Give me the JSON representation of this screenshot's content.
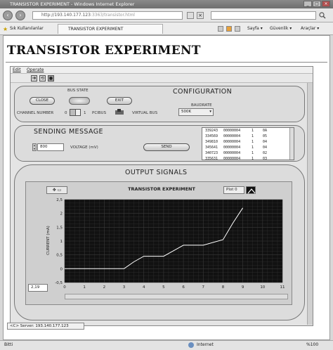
{
  "window": {
    "title": "TRANSISTOR EXPERIMENT - Windows Internet Explorer"
  },
  "browser": {
    "url": "http://193.140.177.123",
    "url_suffix": ":3363/transistor.html",
    "favorites_label": "Sık Kullanılanlar",
    "tab_title": "TRANSISTOR EXPERIMENT",
    "menu_page": "Sayfa ▾",
    "menu_security": "Güvenlik ▾",
    "menu_tools": "Araçlar ▾",
    "status_left": "Bitti",
    "status_zone": "Internet",
    "zoom": "%100"
  },
  "page": {
    "title": "TRANSISTOR EXPERIMENT"
  },
  "vi": {
    "menu": {
      "edit": "Edit",
      "operate": "Operate"
    },
    "config": {
      "title": "CONFIGURATION",
      "bus_state_label": "BUS STATE",
      "close_label": "CLOSE",
      "exit_label": "EXIT",
      "channel_label": "CHANNEL NUMBER",
      "channel_min": "0",
      "channel_max": "1",
      "pcibus_label": "PCIBUS",
      "virtual_bus_label": "VIRTUAL BUS",
      "baudrate_label": "BAUDRATE",
      "baudrate_value": "500K"
    },
    "sending": {
      "title": "SENDING MESSAGE",
      "voltage_value": "800",
      "voltage_label": "VOLTAGE (mV)",
      "send_label": "SEND",
      "log": [
        [
          "339243",
          "00000004",
          "1",
          "0A"
        ],
        [
          "334569",
          "00000004",
          "1",
          "05"
        ],
        [
          "349810",
          "00000004",
          "1",
          "04"
        ],
        [
          "345641",
          "00000004",
          "1",
          "04"
        ],
        [
          "340723",
          "00000004",
          "1",
          "02"
        ],
        [
          "335631",
          "00000004",
          "1",
          "03"
        ]
      ]
    },
    "output": {
      "title": "OUTPUT SIGNALS",
      "plot_legend": "Plot 0",
      "cursor_value": "2,19"
    },
    "taskbar_item": "<C> Server: 193.140.177.123"
  },
  "chart_data": {
    "type": "line",
    "title": "TRANSISTOR EXPERIMENT",
    "xlabel": "",
    "ylabel": "CURRENT (mA)",
    "xlim": [
      0,
      11
    ],
    "ylim": [
      -0.5,
      2.5
    ],
    "xticks": [
      "0",
      "1",
      "2",
      "3",
      "4",
      "5",
      "6",
      "7",
      "8",
      "9",
      "10",
      "11"
    ],
    "yticks": [
      "-0,5",
      "0",
      "0,5",
      "1",
      "1,5",
      "2",
      "2,5"
    ],
    "grid": true,
    "series": [
      {
        "x": [
          0,
          1,
          2,
          3,
          3.5,
          4,
          5,
          6,
          7,
          8,
          8.5,
          9
        ],
        "y": [
          0,
          0,
          0,
          0,
          0.25,
          0.45,
          0.45,
          0.85,
          0.85,
          1.05,
          1.65,
          2.2
        ]
      }
    ],
    "colors": {
      "plot_bg": "#111111",
      "grid": "#3a3a3a",
      "line": "#ffffff"
    }
  }
}
